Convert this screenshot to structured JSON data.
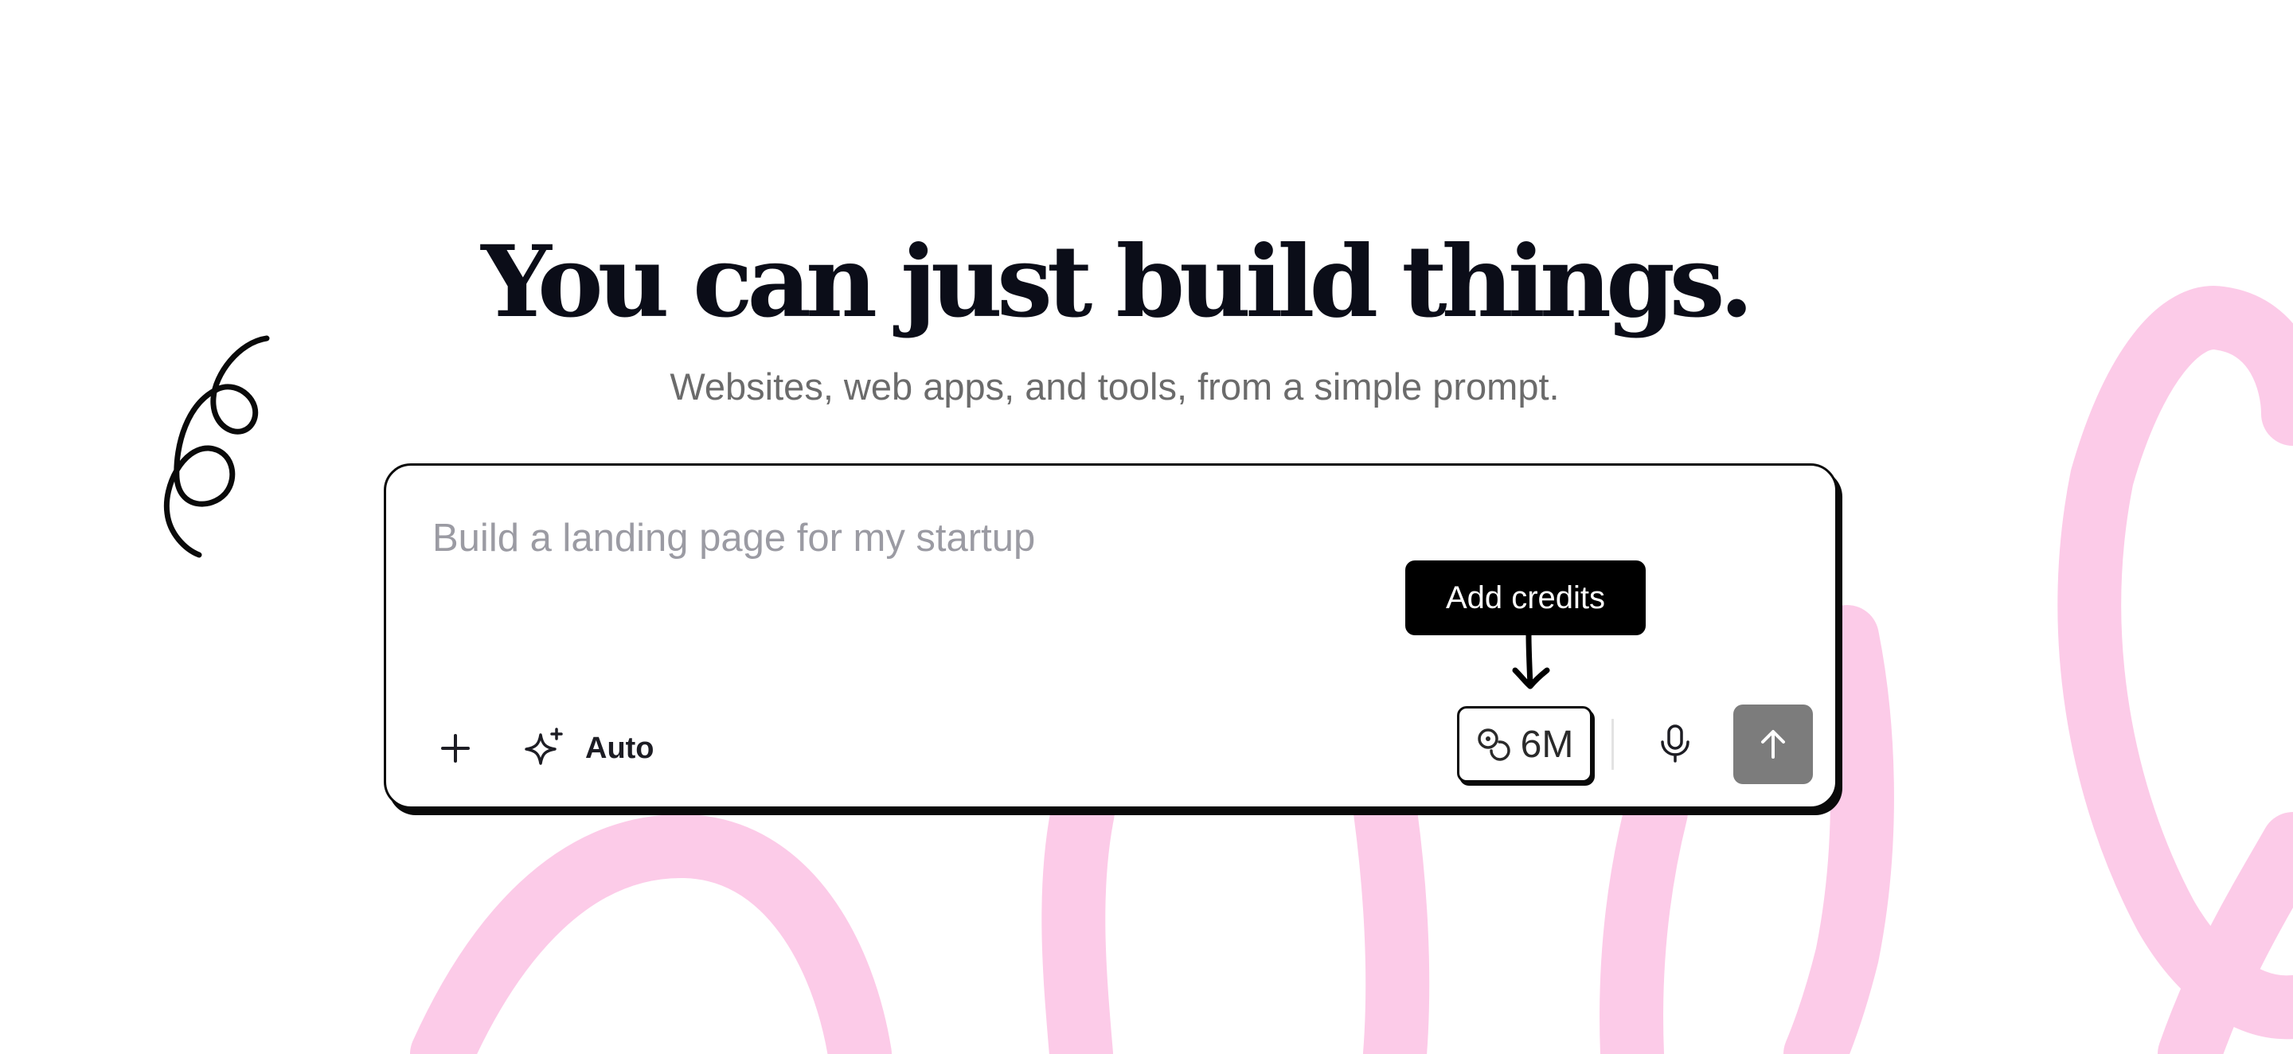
{
  "hero": {
    "headline": "You can just build things.",
    "subtitle": "Websites, web apps, and tools, from a simple prompt."
  },
  "prompt": {
    "placeholder": "Build a landing page for my startup",
    "value": ""
  },
  "toolbar": {
    "add_icon": "plus-icon",
    "model_icon": "sparkles-icon",
    "model_label": "Auto",
    "credits_icon": "coins-icon",
    "credits_value": "6M",
    "mic_icon": "microphone-icon",
    "send_icon": "arrow-up-icon"
  },
  "tooltip": {
    "text": "Add credits"
  },
  "colors": {
    "background": "#ffffff",
    "headline": "#0b0d18",
    "subtitle": "#6b6b6b",
    "placeholder": "#9b9ba3",
    "decoration_pink": "#fccbe8",
    "send_button": "#7c7c7c",
    "tooltip_bg": "#000000"
  }
}
